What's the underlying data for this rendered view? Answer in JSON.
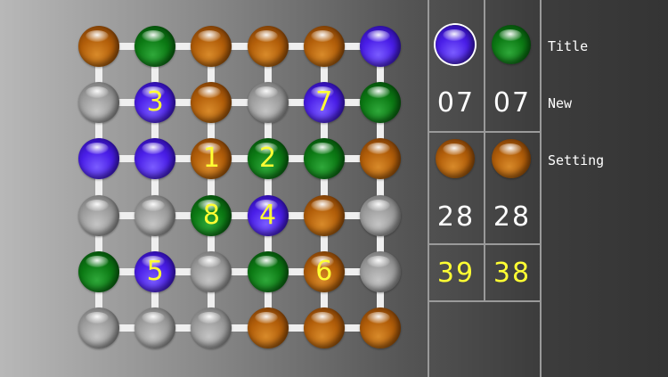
{
  "board": {
    "rows": [
      [
        {
          "color": "orange",
          "label": ""
        },
        {
          "color": "green",
          "label": ""
        },
        {
          "color": "orange",
          "label": ""
        },
        {
          "color": "orange",
          "label": ""
        },
        {
          "color": "orange",
          "label": ""
        },
        {
          "color": "purple",
          "label": ""
        }
      ],
      [
        {
          "color": "gray",
          "label": ""
        },
        {
          "color": "purple",
          "label": "3"
        },
        {
          "color": "orange",
          "label": ""
        },
        {
          "color": "gray",
          "label": ""
        },
        {
          "color": "purple",
          "label": "7"
        },
        {
          "color": "green",
          "label": ""
        }
      ],
      [
        {
          "color": "purple",
          "label": ""
        },
        {
          "color": "purple",
          "label": ""
        },
        {
          "color": "orange",
          "label": "1"
        },
        {
          "color": "green",
          "label": "2"
        },
        {
          "color": "green",
          "label": ""
        },
        {
          "color": "orange",
          "label": ""
        }
      ],
      [
        {
          "color": "gray",
          "label": ""
        },
        {
          "color": "gray",
          "label": ""
        },
        {
          "color": "green",
          "label": "8"
        },
        {
          "color": "purple",
          "label": "4"
        },
        {
          "color": "orange",
          "label": ""
        },
        {
          "color": "gray",
          "label": ""
        }
      ],
      [
        {
          "color": "green",
          "label": ""
        },
        {
          "color": "purple",
          "label": "5"
        },
        {
          "color": "gray",
          "label": ""
        },
        {
          "color": "green",
          "label": ""
        },
        {
          "color": "orange",
          "label": "6"
        },
        {
          "color": "gray",
          "label": ""
        }
      ],
      [
        {
          "color": "gray",
          "label": ""
        },
        {
          "color": "gray",
          "label": ""
        },
        {
          "color": "gray",
          "label": ""
        },
        {
          "color": "orange",
          "label": ""
        },
        {
          "color": "orange",
          "label": ""
        },
        {
          "color": "orange",
          "label": ""
        }
      ]
    ]
  },
  "colors": {
    "orange": "#b35f0a",
    "green": "#0c7a14",
    "purple": "#4a1ee8",
    "gray": "#9a9a9a",
    "number_yellow": "#ffff33",
    "number_white": "#ffffff"
  },
  "panel": {
    "player1": {
      "ball1": "purple",
      "count1": "07",
      "ball2": "orange",
      "count2": "28",
      "score": "39",
      "selected": true
    },
    "player2": {
      "ball1": "green",
      "count1": "07",
      "ball2": "orange",
      "count2": "28",
      "score": "38"
    }
  },
  "menu": {
    "title": "Title",
    "new": "New",
    "setting": "Setting"
  }
}
